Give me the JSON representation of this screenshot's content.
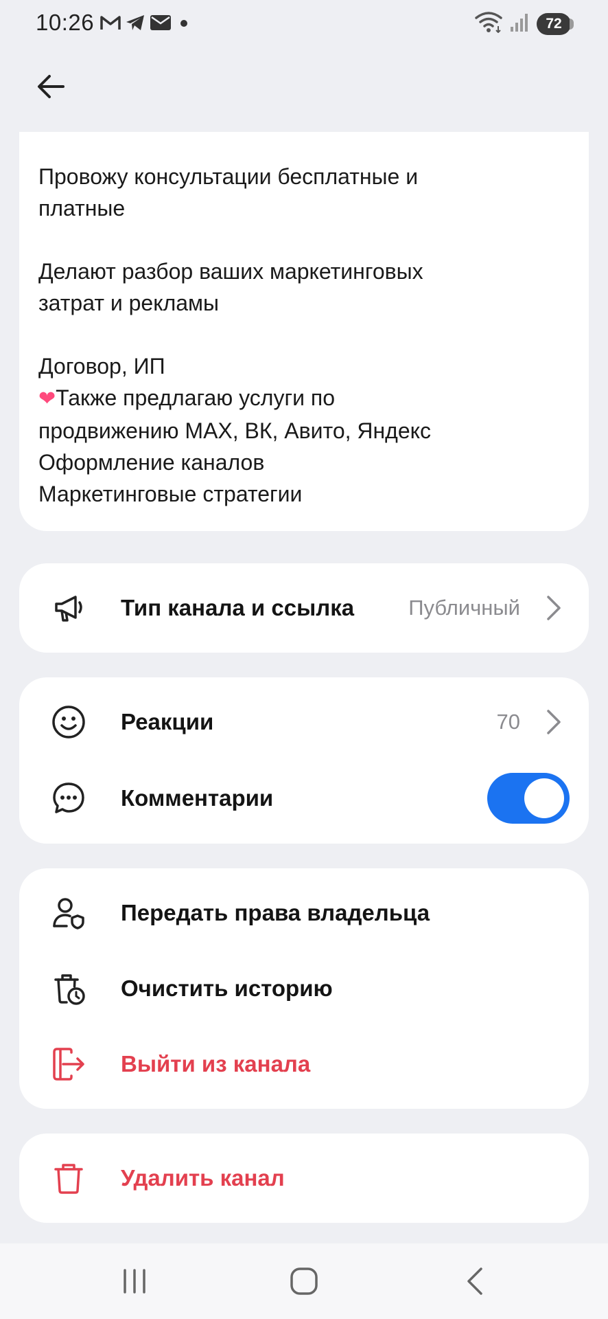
{
  "status_bar": {
    "time": "10:26",
    "battery": "72",
    "notification_icons": [
      "gmail-icon",
      "telegram-icon",
      "mail-icon",
      "dot-icon"
    ],
    "system_icons": [
      "wifi-icon",
      "signal-icon",
      "battery-icon"
    ]
  },
  "description": {
    "lines": [
      "Провожу консультации бесплатные и",
      "платные",
      "",
      "Делают разбор ваших маркетинговых",
      "затрат и рекламы",
      "",
      "Договор, ИП",
      "Также предлагаю услуги по",
      "продвижению MAX, ВК, Авито, Яндекс",
      "Оформление каналов",
      "Маркетинговые стратегии"
    ],
    "emoji": "❤"
  },
  "channel_type": {
    "label": "Тип канала и ссылка",
    "value": "Публичный",
    "icon": "megaphone-icon"
  },
  "reactions": {
    "label": "Реакции",
    "value": "70",
    "icon": "smile-icon"
  },
  "comments": {
    "label": "Комментарии",
    "enabled": true,
    "icon": "chat-bubble-icon"
  },
  "actions": {
    "transfer_label": "Передать права владельца",
    "clear_label": "Очистить историю",
    "leave_label": "Выйти из канала"
  },
  "delete": {
    "label": "Удалить канал"
  },
  "colors": {
    "accent": "#1b73f1",
    "danger": "#e3404f",
    "background": "#eeeff3"
  }
}
